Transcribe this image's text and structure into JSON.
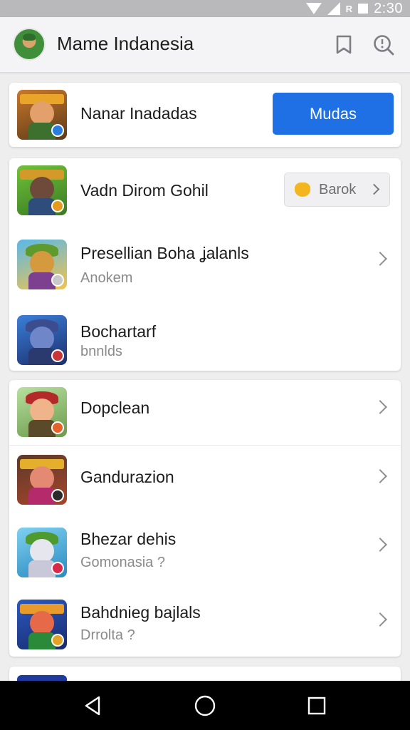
{
  "status_bar": {
    "network": "R",
    "time": "2:30"
  },
  "app_bar": {
    "title": "Mame Indanesia",
    "avatar_icon": "game-character-avatar",
    "actions": [
      "bookmark-icon",
      "search-icon"
    ]
  },
  "featured": {
    "title": "Nanar Inadadas",
    "button_label": "Mudas",
    "accent_color": "#1f6fe5"
  },
  "group1": [
    {
      "title": "Vadn Dirom Gohil",
      "subtitle": "",
      "action_label": "Barok"
    },
    {
      "title": "Presellian Boha ʝalanls",
      "subtitle": "Anokem"
    },
    {
      "title": "Bochartarf",
      "subtitle": "bnnlds"
    }
  ],
  "group2": [
    {
      "title": "Dopclean",
      "subtitle": ""
    },
    {
      "title": "Gandurazion",
      "subtitle": ""
    },
    {
      "title": "Bhezar dehis",
      "subtitle": "Gomonasia ?"
    },
    {
      "title": "Bahdnieg bajlals",
      "subtitle": "Drrolta ?"
    }
  ],
  "nav_bar": {
    "buttons": [
      "back-icon",
      "home-icon",
      "recent-apps-icon"
    ]
  }
}
